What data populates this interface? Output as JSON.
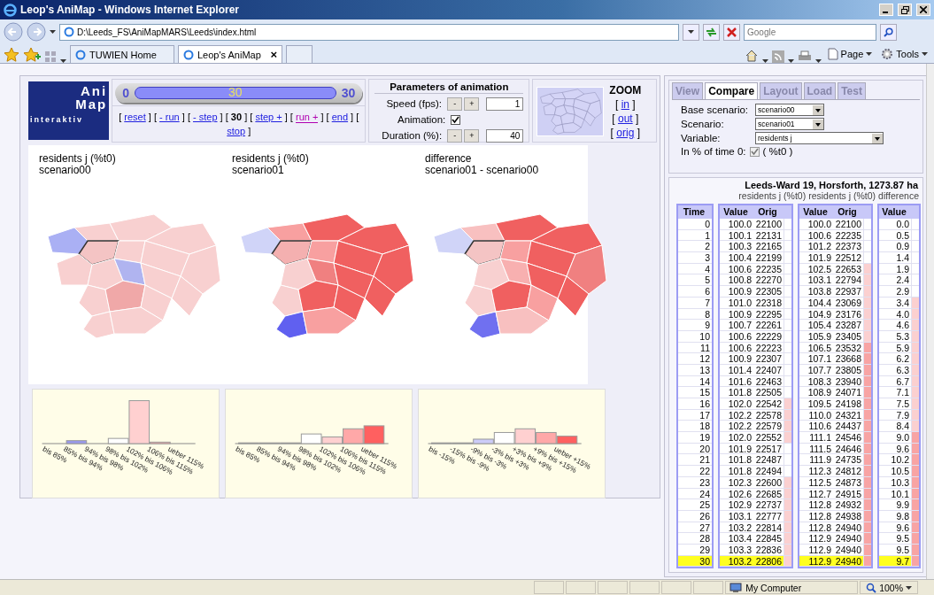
{
  "browser": {
    "title": "Leop's AniMap - Windows Internet Explorer",
    "address": "D:\\Leeds_FS\\AniMapMARS\\Leeds\\index.html",
    "search": {
      "placeholder": "Google"
    },
    "tabs": [
      {
        "label": "TUWIEN Home",
        "selected": false
      },
      {
        "label": "Leop's AniMap",
        "selected": true,
        "close": "×"
      }
    ],
    "toolbar": [
      "Page",
      "Tools"
    ]
  },
  "logo": [
    "Ani",
    "Map",
    "interaktiv"
  ],
  "slider": {
    "min": "0",
    "value": "30",
    "max": "30",
    "level": 1
  },
  "step_controls": {
    "open": "[",
    "close": "]",
    "items": [
      {
        "label": "reset",
        "kind": "link",
        "visited": false
      },
      {
        "label": "- run",
        "kind": "link",
        "visited": false
      },
      {
        "label": "- step",
        "kind": "link",
        "visited": false
      },
      {
        "label": "30",
        "kind": "current"
      },
      {
        "label": "step +",
        "kind": "link",
        "visited": false
      },
      {
        "label": "run +",
        "kind": "link",
        "visited": true
      },
      {
        "label": "end",
        "kind": "link",
        "visited": false
      },
      {
        "label": "stop",
        "kind": "link",
        "visited": false
      }
    ]
  },
  "parameters": {
    "title": "Parameters of animation",
    "speed": {
      "label": "Speed (fps):",
      "minus": "-",
      "plus": "+",
      "value": "1"
    },
    "animation": {
      "label": "Animation:",
      "checked": true
    },
    "duration": {
      "label": "Duration (%):",
      "minus": "-",
      "plus": "+",
      "value": "40"
    }
  },
  "zoom": {
    "title": "ZOOM",
    "open": "[",
    "close": "]",
    "links": [
      "in",
      "out",
      "orig"
    ]
  },
  "maps": [
    {
      "title": "residents j (%t0)",
      "subtitle": "scenario00"
    },
    {
      "title": "residents j (%t0)",
      "subtitle": "scenario01"
    },
    {
      "title": "difference",
      "subtitle": "scenario01 - scenario00"
    }
  ],
  "histograms": [
    {
      "categories": [
        "bis 85%",
        "85% bis 94%",
        "94% bis 98%",
        "98% bis 102%",
        "102% bis 106%",
        "106% bis 115%",
        "ueber 115%"
      ]
    },
    {
      "categories": [
        "bis 85%",
        "85% bis 94%",
        "94% bis 98%",
        "98% bis 102%",
        "102% bis 106%",
        "106% bis 115%",
        "ueber 115%"
      ]
    },
    {
      "categories": [
        "bis -15%",
        "-15% bis -9%",
        "-9% bis -3%",
        "-3% bis +3%",
        "+3% bis +9%",
        "+9% bis +15%",
        "ueber +15%"
      ]
    }
  ],
  "panel": {
    "tabs": [
      {
        "label": "View",
        "selected": false
      },
      {
        "label": "Compare",
        "selected": true
      },
      {
        "label": "Layout",
        "selected": false
      },
      {
        "label": "Load",
        "selected": false
      },
      {
        "label": "Test",
        "selected": false
      }
    ],
    "base_scenario": {
      "label": "Base scenario:",
      "value": "scenario00"
    },
    "scenario": {
      "label": "Scenario:",
      "value": "scenario01"
    },
    "variable": {
      "label": "Variable:",
      "value": "residents j"
    },
    "percent_of_time0": {
      "label": "In % of time 0:",
      "checked": true,
      "suffix": "( %t0 )"
    }
  },
  "table": {
    "title": "Leeds-Ward 19, Horsforth, 1273.87 ha",
    "groups": [
      "residents j (%t0)",
      "residents j (%t0)",
      "difference"
    ],
    "columns": [
      "Time",
      "Value",
      "Orig",
      "Value",
      "Orig",
      "Value"
    ],
    "rows": [
      {
        "time": "0",
        "base": {
          "value": "100.0",
          "orig": "22100",
          "color": "#ffffff"
        },
        "scenario": {
          "value": "100.0",
          "orig": "22100",
          "color": "#ffffff"
        },
        "difference": {
          "value": "0.0",
          "color": "#ffffff"
        },
        "selected": false
      },
      {
        "time": "1",
        "base": {
          "value": "100.1",
          "orig": "22131",
          "color": "#ffffff"
        },
        "scenario": {
          "value": "100.6",
          "orig": "22235",
          "color": "#ffffff"
        },
        "difference": {
          "value": "0.5",
          "color": "#ffffff"
        },
        "selected": false
      },
      {
        "time": "2",
        "base": {
          "value": "100.3",
          "orig": "22165",
          "color": "#ffffff"
        },
        "scenario": {
          "value": "101.2",
          "orig": "22373",
          "color": "#ffffff"
        },
        "difference": {
          "value": "0.9",
          "color": "#ffffff"
        },
        "selected": false
      },
      {
        "time": "3",
        "base": {
          "value": "100.4",
          "orig": "22199",
          "color": "#ffffff"
        },
        "scenario": {
          "value": "101.9",
          "orig": "22512",
          "color": "#ffffff"
        },
        "difference": {
          "value": "1.4",
          "color": "#ffffff"
        },
        "selected": false
      },
      {
        "time": "4",
        "base": {
          "value": "100.6",
          "orig": "22235",
          "color": "#ffffff"
        },
        "scenario": {
          "value": "102.5",
          "orig": "22653",
          "color": "#fbd0d0"
        },
        "difference": {
          "value": "1.9",
          "color": "#ffffff"
        },
        "selected": false
      },
      {
        "time": "5",
        "base": {
          "value": "100.8",
          "orig": "22270",
          "color": "#ffffff"
        },
        "scenario": {
          "value": "103.1",
          "orig": "22794",
          "color": "#fbd0d0"
        },
        "difference": {
          "value": "2.4",
          "color": "#ffffff"
        },
        "selected": false
      },
      {
        "time": "6",
        "base": {
          "value": "100.9",
          "orig": "22305",
          "color": "#ffffff"
        },
        "scenario": {
          "value": "103.8",
          "orig": "22937",
          "color": "#fbd0d0"
        },
        "difference": {
          "value": "2.9",
          "color": "#ffffff"
        },
        "selected": false
      },
      {
        "time": "7",
        "base": {
          "value": "101.0",
          "orig": "22318",
          "color": "#ffffff"
        },
        "scenario": {
          "value": "104.4",
          "orig": "23069",
          "color": "#fbd0d0"
        },
        "difference": {
          "value": "3.4",
          "color": "#fbd0d0"
        },
        "selected": false
      },
      {
        "time": "8",
        "base": {
          "value": "100.9",
          "orig": "22295",
          "color": "#ffffff"
        },
        "scenario": {
          "value": "104.9",
          "orig": "23176",
          "color": "#fbd0d0"
        },
        "difference": {
          "value": "4.0",
          "color": "#fbd0d0"
        },
        "selected": false
      },
      {
        "time": "9",
        "base": {
          "value": "100.7",
          "orig": "22261",
          "color": "#ffffff"
        },
        "scenario": {
          "value": "105.4",
          "orig": "23287",
          "color": "#fbd0d0"
        },
        "difference": {
          "value": "4.6",
          "color": "#fbd0d0"
        },
        "selected": false
      },
      {
        "time": "10",
        "base": {
          "value": "100.6",
          "orig": "22229",
          "color": "#ffffff"
        },
        "scenario": {
          "value": "105.9",
          "orig": "23405",
          "color": "#fbd0d0"
        },
        "difference": {
          "value": "5.3",
          "color": "#fbd0d0"
        },
        "selected": false
      },
      {
        "time": "11",
        "base": {
          "value": "100.6",
          "orig": "22223",
          "color": "#ffffff"
        },
        "scenario": {
          "value": "106.5",
          "orig": "23532",
          "color": "#f8a4a4"
        },
        "difference": {
          "value": "5.9",
          "color": "#fbd0d0"
        },
        "selected": false
      },
      {
        "time": "12",
        "base": {
          "value": "100.9",
          "orig": "22307",
          "color": "#ffffff"
        },
        "scenario": {
          "value": "107.1",
          "orig": "23668",
          "color": "#f8a4a4"
        },
        "difference": {
          "value": "6.2",
          "color": "#fbd0d0"
        },
        "selected": false
      },
      {
        "time": "13",
        "base": {
          "value": "101.4",
          "orig": "22407",
          "color": "#ffffff"
        },
        "scenario": {
          "value": "107.7",
          "orig": "23805",
          "color": "#f8a4a4"
        },
        "difference": {
          "value": "6.3",
          "color": "#fbd0d0"
        },
        "selected": false
      },
      {
        "time": "14",
        "base": {
          "value": "101.6",
          "orig": "22463",
          "color": "#ffffff"
        },
        "scenario": {
          "value": "108.3",
          "orig": "23940",
          "color": "#f8a4a4"
        },
        "difference": {
          "value": "6.7",
          "color": "#fbd0d0"
        },
        "selected": false
      },
      {
        "time": "15",
        "base": {
          "value": "101.8",
          "orig": "22505",
          "color": "#ffffff"
        },
        "scenario": {
          "value": "108.9",
          "orig": "24071",
          "color": "#f8a4a4"
        },
        "difference": {
          "value": "7.1",
          "color": "#fbd0d0"
        },
        "selected": false
      },
      {
        "time": "16",
        "base": {
          "value": "102.0",
          "orig": "22542",
          "color": "#fbd0d0"
        },
        "scenario": {
          "value": "109.5",
          "orig": "24198",
          "color": "#f8a4a4"
        },
        "difference": {
          "value": "7.5",
          "color": "#fbd0d0"
        },
        "selected": false
      },
      {
        "time": "17",
        "base": {
          "value": "102.2",
          "orig": "22578",
          "color": "#fbd0d0"
        },
        "scenario": {
          "value": "110.0",
          "orig": "24321",
          "color": "#f8a4a4"
        },
        "difference": {
          "value": "7.9",
          "color": "#fbd0d0"
        },
        "selected": false
      },
      {
        "time": "18",
        "base": {
          "value": "102.2",
          "orig": "22579",
          "color": "#fbd0d0"
        },
        "scenario": {
          "value": "110.6",
          "orig": "24437",
          "color": "#f8a4a4"
        },
        "difference": {
          "value": "8.4",
          "color": "#fbd0d0"
        },
        "selected": false
      },
      {
        "time": "19",
        "base": {
          "value": "102.0",
          "orig": "22552",
          "color": "#fbd0d0"
        },
        "scenario": {
          "value": "111.1",
          "orig": "24546",
          "color": "#f8a4a4"
        },
        "difference": {
          "value": "9.0",
          "color": "#f8a4a4"
        },
        "selected": false
      },
      {
        "time": "20",
        "base": {
          "value": "101.9",
          "orig": "22517",
          "color": "#ffffff"
        },
        "scenario": {
          "value": "111.5",
          "orig": "24646",
          "color": "#f8a4a4"
        },
        "difference": {
          "value": "9.6",
          "color": "#f8a4a4"
        },
        "selected": false
      },
      {
        "time": "21",
        "base": {
          "value": "101.8",
          "orig": "22487",
          "color": "#ffffff"
        },
        "scenario": {
          "value": "111.9",
          "orig": "24735",
          "color": "#f8a4a4"
        },
        "difference": {
          "value": "10.2",
          "color": "#f8a4a4"
        },
        "selected": false
      },
      {
        "time": "22",
        "base": {
          "value": "101.8",
          "orig": "22494",
          "color": "#ffffff"
        },
        "scenario": {
          "value": "112.3",
          "orig": "24812",
          "color": "#f8a4a4"
        },
        "difference": {
          "value": "10.5",
          "color": "#f8a4a4"
        },
        "selected": false
      },
      {
        "time": "23",
        "base": {
          "value": "102.3",
          "orig": "22600",
          "color": "#fbd0d0"
        },
        "scenario": {
          "value": "112.5",
          "orig": "24873",
          "color": "#f8a4a4"
        },
        "difference": {
          "value": "10.3",
          "color": "#f8a4a4"
        },
        "selected": false
      },
      {
        "time": "24",
        "base": {
          "value": "102.6",
          "orig": "22685",
          "color": "#fbd0d0"
        },
        "scenario": {
          "value": "112.7",
          "orig": "24915",
          "color": "#f8a4a4"
        },
        "difference": {
          "value": "10.1",
          "color": "#f8a4a4"
        },
        "selected": false
      },
      {
        "time": "25",
        "base": {
          "value": "102.9",
          "orig": "22737",
          "color": "#fbd0d0"
        },
        "scenario": {
          "value": "112.8",
          "orig": "24932",
          "color": "#f8a4a4"
        },
        "difference": {
          "value": "9.9",
          "color": "#f8a4a4"
        },
        "selected": false
      },
      {
        "time": "26",
        "base": {
          "value": "103.1",
          "orig": "22777",
          "color": "#fbd0d0"
        },
        "scenario": {
          "value": "112.8",
          "orig": "24938",
          "color": "#f8a4a4"
        },
        "difference": {
          "value": "9.8",
          "color": "#f8a4a4"
        },
        "selected": false
      },
      {
        "time": "27",
        "base": {
          "value": "103.2",
          "orig": "22814",
          "color": "#fbd0d0"
        },
        "scenario": {
          "value": "112.8",
          "orig": "24940",
          "color": "#f8a4a4"
        },
        "difference": {
          "value": "9.6",
          "color": "#f8a4a4"
        },
        "selected": false
      },
      {
        "time": "28",
        "base": {
          "value": "103.4",
          "orig": "22845",
          "color": "#fbd0d0"
        },
        "scenario": {
          "value": "112.9",
          "orig": "24940",
          "color": "#f8a4a4"
        },
        "difference": {
          "value": "9.5",
          "color": "#f8a4a4"
        },
        "selected": false
      },
      {
        "time": "29",
        "base": {
          "value": "103.3",
          "orig": "22836",
          "color": "#fbd0d0"
        },
        "scenario": {
          "value": "112.9",
          "orig": "24940",
          "color": "#f8a4a4"
        },
        "difference": {
          "value": "9.5",
          "color": "#f8a4a4"
        },
        "selected": false
      },
      {
        "time": "30",
        "base": {
          "value": "103.2",
          "orig": "22806",
          "color": "#fbd0d0"
        },
        "scenario": {
          "value": "112.9",
          "orig": "24940",
          "color": "#f8a4a4"
        },
        "difference": {
          "value": "9.7",
          "color": "#f8a4a4"
        },
        "selected": true
      }
    ]
  },
  "status_bar": {
    "zone": "My Computer",
    "zoom": "100%"
  }
}
